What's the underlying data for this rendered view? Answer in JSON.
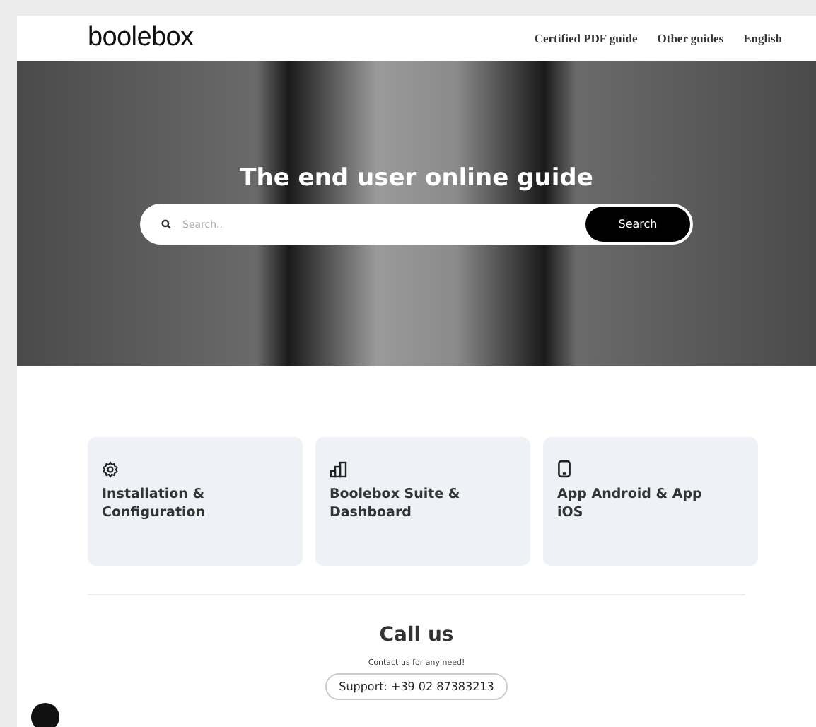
{
  "header": {
    "logo": "boolebox",
    "nav": [
      "Certified PDF guide",
      "Other guides",
      "English"
    ]
  },
  "hero": {
    "title": "The end user online guide",
    "search": {
      "placeholder": "Search..",
      "button": "Search"
    }
  },
  "cards": [
    {
      "kind": "gear",
      "title": "Installation & Configuration"
    },
    {
      "kind": "chart",
      "title": "Boolebox Suite & Dashboard"
    },
    {
      "kind": "phone",
      "title": "App Android & App iOS"
    }
  ],
  "contact": {
    "title": "Call us",
    "text": "Contact us for any need!",
    "button": "Support: +39 02 87383213"
  }
}
